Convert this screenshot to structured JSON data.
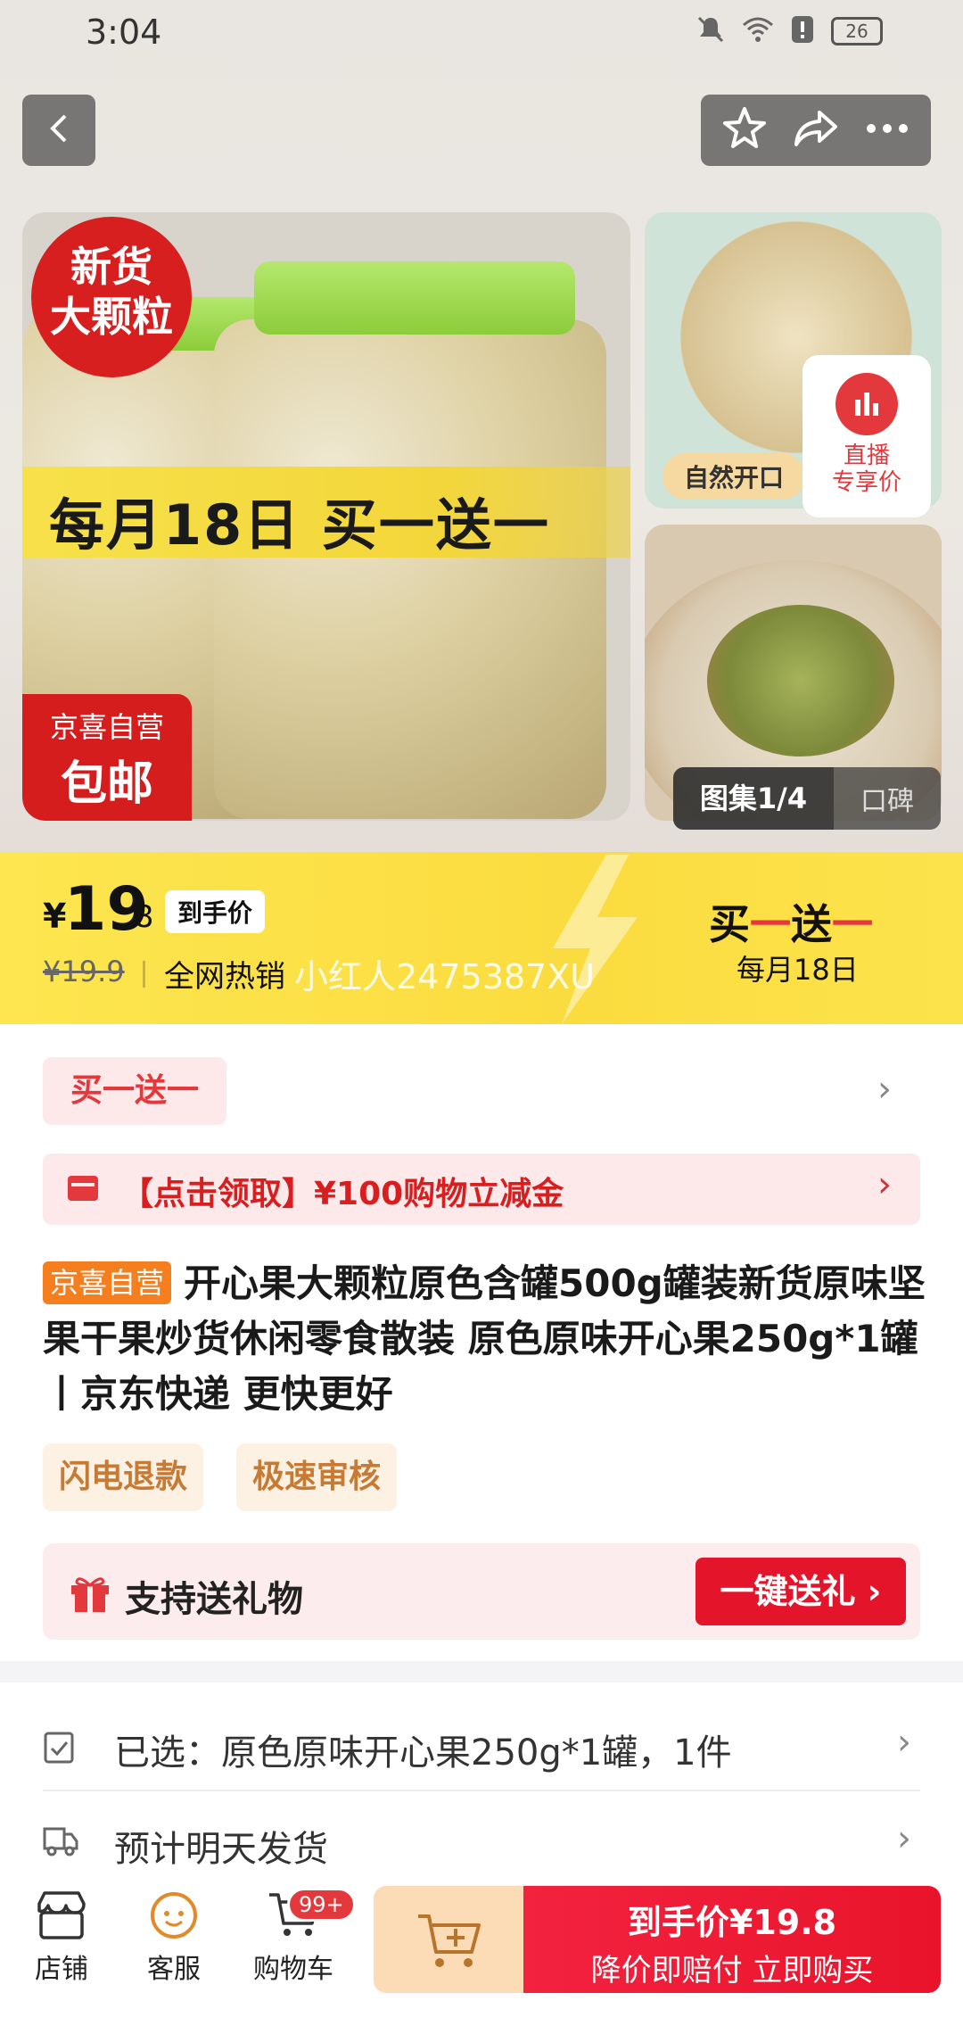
{
  "status_bar": {
    "time": "3:04",
    "battery": "26"
  },
  "gallery": {
    "main_badge_new": "新货\n大颗粒",
    "main_promo": "每月18日 买一送一",
    "main_badge_free_l1": "京喜自营",
    "main_badge_free_l2": "包邮",
    "thumb1_tag": "自然开口",
    "live_label": "直播\n专享价",
    "gallery_count": "图集1/4",
    "reviews_tab": "口碑"
  },
  "price": {
    "currency": "¥",
    "integer": "19",
    "decimal": ".8",
    "tag": "到手价",
    "original": "¥19.9",
    "hot_text": "全网热销",
    "watermark": "小红人2475387XU",
    "bogo_left": "买",
    "bogo_dash": "一",
    "bogo_mid": "送",
    "bogo_dash2": "一",
    "bogo_date": "每月18日"
  },
  "promos": {
    "bogo_pill": "买一送一",
    "coupon_text": "【点击领取】¥100购物立减金"
  },
  "product": {
    "store_badge": "京喜自营",
    "title": "开心果大颗粒原色含罐500g罐装新货原味坚果干果炒货休闲零食散装 原色原味开心果250g*1罐丨京东快递 更快更好",
    "tag_refund": "闪电退款",
    "tag_review": "极速审核"
  },
  "gift": {
    "label": "支持送礼物",
    "button": "一键送礼 ›"
  },
  "selection": {
    "selected": "已选：原色原味开心果250g*1罐，1件",
    "shipping": "预计明天发货"
  },
  "bottom_bar": {
    "store": "店铺",
    "service": "客服",
    "cart": "购物车",
    "cart_badge": "99+",
    "buy_l1": "到手价¥19.8",
    "buy_l2": "降价即赔付 立即购买"
  },
  "colors": {
    "accent_red": "#e4393c",
    "price_yellow": "#fde650",
    "store_orange": "#f57e1e"
  }
}
